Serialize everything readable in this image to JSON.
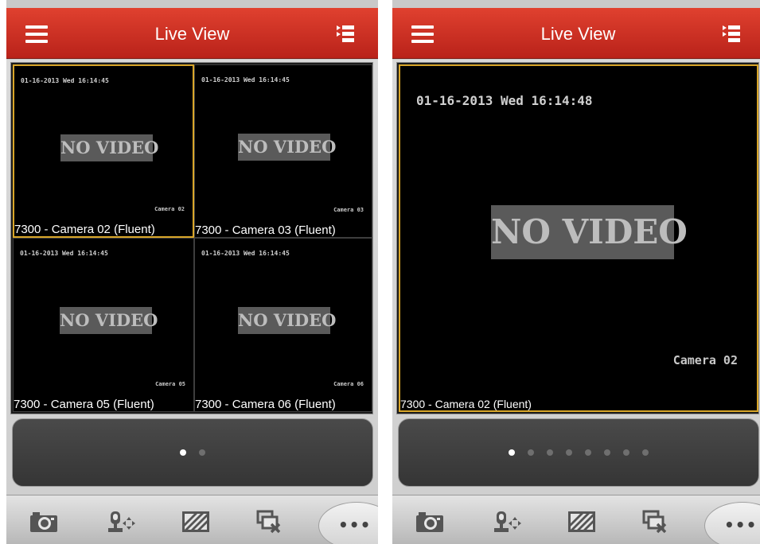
{
  "screens": [
    {
      "title": "Live View",
      "tiles": [
        {
          "timestamp": "01-16-2013 Wed 16:14:45",
          "no_video": "NO VIDEO",
          "camera_osd": "Camera 02",
          "caption": "7300 - Camera 02 (Fluent)",
          "selected": true
        },
        {
          "timestamp": "01-16-2013 Wed 16:14:45",
          "no_video": "NO VIDEO",
          "camera_osd": "Camera 03",
          "caption": "7300 - Camera 03 (Fluent)",
          "selected": false
        },
        {
          "timestamp": "01-16-2013 Wed 16:14:45",
          "no_video": "NO VIDEO",
          "camera_osd": "Camera 05",
          "caption": "7300 - Camera 05 (Fluent)",
          "selected": false
        },
        {
          "timestamp": "01-16-2013 Wed 16:14:45",
          "no_video": "NO VIDEO",
          "camera_osd": "Camera 06",
          "caption": "7300 - Camera 06 (Fluent)",
          "selected": false
        }
      ],
      "page_count": 2,
      "active_page": 1
    },
    {
      "title": "Live View",
      "tiles": [
        {
          "timestamp": "01-16-2013 Wed 16:14:48",
          "no_video": "NO VIDEO",
          "camera_osd": "Camera 02",
          "caption": "7300 - Camera 02 (Fluent)",
          "selected": true
        }
      ],
      "page_count": 8,
      "active_page": 1
    }
  ],
  "toolbar": {
    "items": [
      "camera-icon",
      "ptz-icon",
      "image-quality-icon",
      "close-all-icon"
    ],
    "more_label": "•••"
  },
  "colors": {
    "navbar": "#c8291f",
    "selected_border": "#d9a629",
    "pager": "#3f3f3f"
  }
}
